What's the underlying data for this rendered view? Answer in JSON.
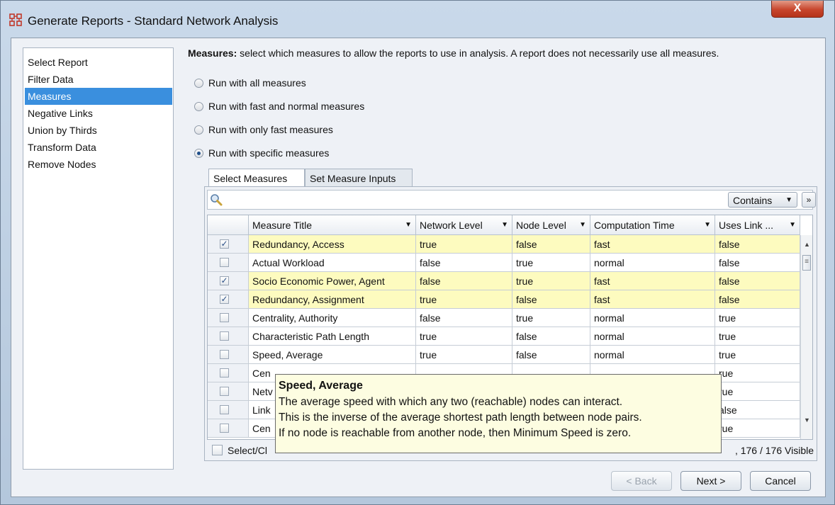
{
  "window": {
    "title": "Generate Reports - Standard Network Analysis",
    "close_label": "X"
  },
  "sidebar": {
    "items": [
      {
        "label": "Select Report",
        "selected": false
      },
      {
        "label": "Filter Data",
        "selected": false
      },
      {
        "label": "Measures",
        "selected": true
      },
      {
        "label": "Negative Links",
        "selected": false
      },
      {
        "label": "Union by Thirds",
        "selected": false
      },
      {
        "label": "Transform Data",
        "selected": false
      },
      {
        "label": "Remove Nodes",
        "selected": false
      }
    ]
  },
  "main": {
    "desc_bold": "Measures:",
    "desc_rest": " select which measures to allow the reports to use in analysis. A report does not necessarily use all measures.",
    "radios": [
      {
        "label": "Run with all measures",
        "checked": false
      },
      {
        "label": "Run with fast and normal measures",
        "checked": false
      },
      {
        "label": "Run with only fast measures",
        "checked": false
      },
      {
        "label": "Run with specific measures",
        "checked": true
      }
    ],
    "tabs": [
      {
        "label": "Select Measures",
        "active": true
      },
      {
        "label": "Set Measure Inputs",
        "active": false
      }
    ],
    "filter": {
      "mode": "Contains",
      "expand_icon": "double-chevron-down-icon"
    },
    "table": {
      "columns": [
        "",
        "Measure Title",
        "Network Level",
        "Node Level",
        "Computation Time",
        "Uses Link ..."
      ],
      "rows": [
        {
          "checked": true,
          "highlight": true,
          "cells": [
            "Redundancy, Access",
            "true",
            "false",
            "fast",
            "false"
          ]
        },
        {
          "checked": false,
          "highlight": false,
          "cells": [
            "Actual Workload",
            "false",
            "true",
            "normal",
            "false"
          ]
        },
        {
          "checked": true,
          "highlight": true,
          "cells": [
            "Socio Economic Power, Agent",
            "false",
            "true",
            "fast",
            "false"
          ]
        },
        {
          "checked": true,
          "highlight": true,
          "cells": [
            "Redundancy, Assignment",
            "true",
            "false",
            "fast",
            "false"
          ]
        },
        {
          "checked": false,
          "highlight": false,
          "cells": [
            "Centrality, Authority",
            "false",
            "true",
            "normal",
            "true"
          ]
        },
        {
          "checked": false,
          "highlight": false,
          "cells": [
            "Characteristic Path Length",
            "true",
            "false",
            "normal",
            "true"
          ]
        },
        {
          "checked": false,
          "highlight": false,
          "cells": [
            "Speed, Average",
            "true",
            "false",
            "normal",
            "true"
          ]
        },
        {
          "checked": false,
          "highlight": false,
          "cells": [
            "Cen",
            "",
            "",
            "",
            "rue"
          ]
        },
        {
          "checked": false,
          "highlight": false,
          "cells": [
            "Netv",
            "",
            "",
            "",
            "rue"
          ]
        },
        {
          "checked": false,
          "highlight": false,
          "cells": [
            "Link",
            "",
            "",
            "",
            "alse"
          ]
        },
        {
          "checked": false,
          "highlight": false,
          "cells": [
            "Cen",
            "",
            "",
            "",
            "rue"
          ]
        }
      ]
    },
    "footer": {
      "select_clear_label": "Select/Cl",
      "visible_count": ", 176 / 176 Visible"
    },
    "tooltip": {
      "title": "Speed, Average",
      "lines": [
        "The average speed with which any two (reachable) nodes can interact.",
        "This is the inverse of the average shortest path length between node pairs.",
        "If no node is reachable from another node, then Minimum Speed is zero."
      ]
    }
  },
  "buttons": {
    "back": "< Back",
    "next": "Next >",
    "cancel": "Cancel"
  },
  "colors": {
    "selection": "#3a8fde",
    "highlight_row": "#fdfbbf",
    "tooltip_bg": "#fdfde1",
    "close_button": "#c7452c"
  }
}
